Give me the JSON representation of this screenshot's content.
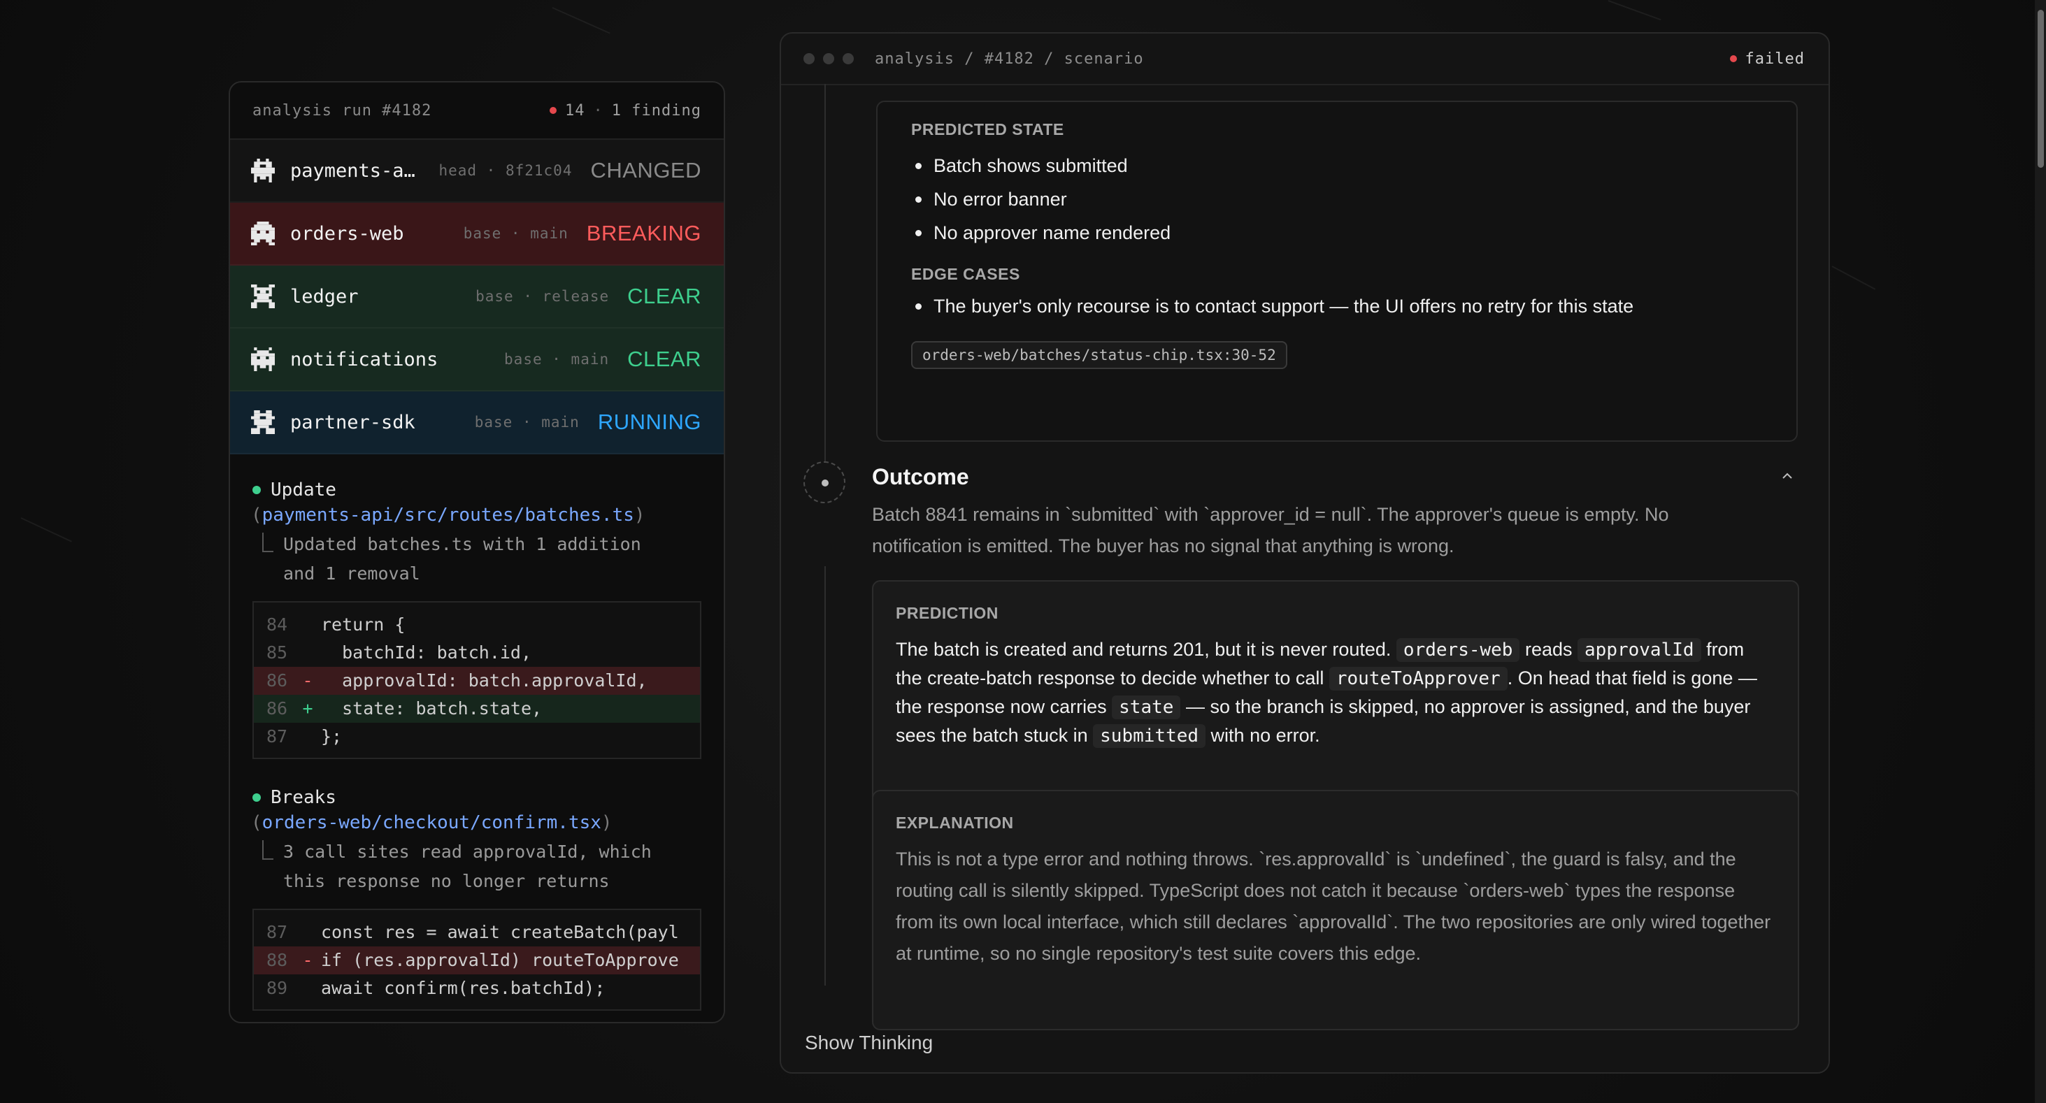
{
  "left_panel": {
    "header": {
      "title": "analysis run #4182",
      "count": "14",
      "findings": "1 finding"
    },
    "repos": [
      {
        "name": "payments-a…",
        "ref_kind": "head",
        "ref": "8f21c04",
        "status": "CHANGED",
        "status_color": "#8a8a8a"
      },
      {
        "name": "orders-web",
        "ref_kind": "base",
        "ref": "main",
        "status": "BREAKING",
        "status_color": "#ff5c5c"
      },
      {
        "name": "ledger",
        "ref_kind": "base",
        "ref": "release",
        "status": "CLEAR",
        "status_color": "#3ecf8e"
      },
      {
        "name": "notifications",
        "ref_kind": "base",
        "ref": "main",
        "status": "CLEAR",
        "status_color": "#3ecf8e"
      },
      {
        "name": "partner-sdk",
        "ref_kind": "base",
        "ref": "main",
        "status": "RUNNING",
        "status_color": "#2ea7ff"
      }
    ],
    "update": {
      "title": "Update",
      "path": "payments-api/src/routes/batches.ts",
      "desc_line1": "Updated batches.ts with 1 addition",
      "desc_line2": "and 1 removal",
      "code": [
        {
          "ln": "84",
          "mk": "",
          "src": "return {"
        },
        {
          "ln": "85",
          "mk": "",
          "src": "  batchId: batch.id,"
        },
        {
          "ln": "86",
          "mk": "-",
          "src": "  approvalId: batch.approvalId,"
        },
        {
          "ln": "86",
          "mk": "+",
          "src": "  state: batch.state,"
        },
        {
          "ln": "87",
          "mk": "",
          "src": "};"
        }
      ]
    },
    "breaks": {
      "title": "Breaks",
      "path": "orders-web/checkout/confirm.tsx",
      "desc_line1": "3 call sites read approvalId, which",
      "desc_line2": "this response no longer returns",
      "code": [
        {
          "ln": "87",
          "mk": "",
          "src": "const res = await createBatch(payl"
        },
        {
          "ln": "88",
          "mk": "-",
          "src": "if (res.approvalId) routeToApprove"
        },
        {
          "ln": "89",
          "mk": "",
          "src": "await confirm(res.batchId);"
        }
      ]
    }
  },
  "right_panel": {
    "breadcrumb": "analysis / #4182 / scenario",
    "status": "failed",
    "predicted_state": {
      "label": "PREDICTED STATE",
      "items": [
        "Batch shows submitted",
        "No error banner",
        "No approver name rendered"
      ]
    },
    "edge_cases": {
      "label": "EDGE CASES",
      "items": [
        "The buyer's only recourse is to contact support — the UI offers no retry for this state"
      ],
      "file": "orders-web/batches/status-chip.tsx:30-52"
    },
    "outcome": {
      "title": "Outcome",
      "text": "Batch 8841 remains in `submitted` with `approver_id = null`. The approver's queue is empty. No notification is emitted. The buyer has no signal that anything is wrong."
    },
    "prediction": {
      "label": "PREDICTION",
      "t1": "The batch is created and returns 201, but it is never routed. ",
      "c1": "orders-web",
      "t2": " reads ",
      "c2": "approvalId",
      "t3": " from the create-batch response to decide whether to call ",
      "c3": "routeToApprover",
      "t4": ". On head that field is gone — the response now carries ",
      "c4": "state",
      "t5": " — so the branch is skipped, no approver is assigned, and the buyer sees the batch stuck in ",
      "c5": "submitted",
      "t6": " with no error."
    },
    "explanation": {
      "label": "EXPLANATION",
      "text": "This is not a type error and nothing throws. `res.approvalId` is `undefined`, the guard is falsy, and the routing call is silently skipped. TypeScript does not catch it because `orders-web` types the response from its own local interface, which still declares `approvalId`. The two repositories are only wired together at runtime, so no single repository's test suite covers this edge."
    },
    "show_thinking": "Show Thinking"
  },
  "colors": {
    "breaking_bg": "#3a1618",
    "clear_bg": "#172a20",
    "running_bg": "#10222e",
    "accent_red": "#e5484d",
    "accent_green": "#3ecf8e"
  }
}
